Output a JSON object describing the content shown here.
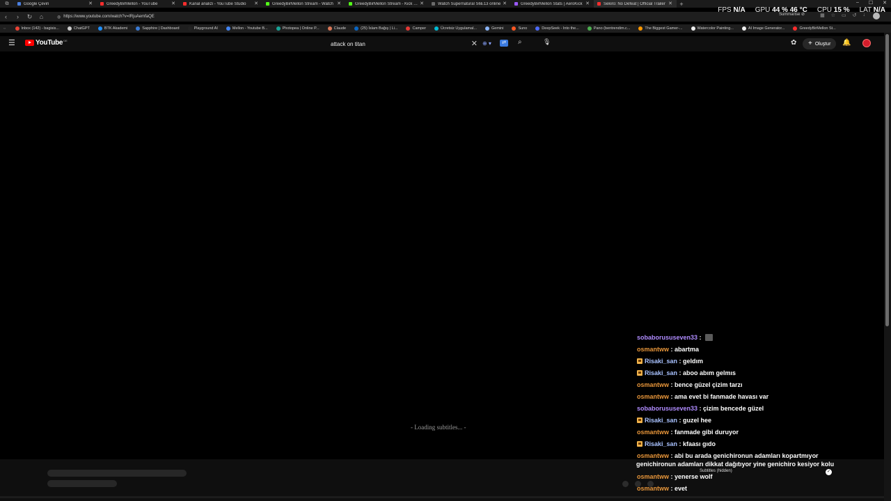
{
  "browser": {
    "tabs": [
      {
        "title": "Google Çeviri",
        "color": "#4a7fe0",
        "active": false
      },
      {
        "title": "GreedyBirMellon - YouTube",
        "color": "#ff2d2d",
        "active": false
      },
      {
        "title": "Kanal analizi - YouTube Studio",
        "color": "#ff2d2d",
        "active": false
      },
      {
        "title": "GreedyBirMellon Stream - Watch",
        "color": "#53fc18",
        "active": false
      },
      {
        "title": "GreedyBirMellon Stream - Kick Dash",
        "color": "#53fc18",
        "active": false
      },
      {
        "title": "Watch Supernatural S6E13 online",
        "color": "#6b6b6b",
        "active": false
      },
      {
        "title": "GreedyBirMellon Stats | AeroKick",
        "color": "#9b59ff",
        "active": false
      },
      {
        "title": "Sekiro: No Defeat | Official Trailer",
        "color": "#ff2d2d",
        "active": true
      }
    ],
    "new_tab": "+",
    "url": "https://www.youtube.com/watch?v=IRjuAemfaQE",
    "summarise_label": "Summarise",
    "bookmarks": [
      {
        "label": "Inbox (142) - bagisis...",
        "color": "#ea4335"
      },
      {
        "label": "ChatGPT",
        "color": "#cccccc"
      },
      {
        "label": "BTK Akademi",
        "color": "#1e90ff"
      },
      {
        "label": "Sapphire | Dashboard",
        "color": "#3a7bd5"
      },
      {
        "label": "Playground AI",
        "color": "#222222"
      },
      {
        "label": "Mellon - Youtube B...",
        "color": "#4285f4"
      },
      {
        "label": "Photopea | Online P...",
        "color": "#18a497"
      },
      {
        "label": "Claude",
        "color": "#d97757"
      },
      {
        "label": "(25) İslam Bağış | Li...",
        "color": "#0a66c2"
      },
      {
        "label": "Camper",
        "color": "#e53935"
      },
      {
        "label": "Ücretsiz Uygulamal...",
        "color": "#00bcd4"
      },
      {
        "label": "Gemini",
        "color": "#8ab4f8"
      },
      {
        "label": "Suno",
        "color": "#ff5722"
      },
      {
        "label": "DeepSeek - Into the...",
        "color": "#4d6bfe"
      },
      {
        "label": "Pano (bentrendim.c...",
        "color": "#4caf50"
      },
      {
        "label": "The Biggest Gamer-...",
        "color": "#ff9800"
      },
      {
        "label": "Watercolor Painting...",
        "color": "#eeeeee"
      },
      {
        "label": "AI Image Generator...",
        "color": "#eeeeee"
      },
      {
        "label": "GreedyBirMellon St...",
        "color": "#ff2d2d"
      }
    ]
  },
  "perf": {
    "fps_label": "FPS",
    "fps_value": "N/A",
    "gpu_label": "GPU",
    "gpu_value": "44 %",
    "gpu_temp": "46 °C",
    "cpu_label": "CPU",
    "cpu_value": "15 %",
    "lat_label": "LAT",
    "lat_value": "N/A"
  },
  "youtube": {
    "logo_text": "YouTube",
    "country_code": "DE",
    "search_value": "attack on titan",
    "create_label": "Oluştur"
  },
  "player": {
    "loading_subtitles": "- Loading subtitles... -",
    "subtitles_hidden": "Subtitles (hidden)"
  },
  "chat": {
    "messages": [
      {
        "user": "sobaborususeven33",
        "text": "",
        "user_color": "#b08cff",
        "badge": false,
        "emote": true
      },
      {
        "user": "osmantww",
        "text": "abartma",
        "user_color": "#e8963a",
        "badge": false,
        "emote": false
      },
      {
        "user": "Risaki_san",
        "text": "geldım",
        "user_color": "#a9c2ff",
        "badge": true,
        "emote": false
      },
      {
        "user": "Risaki_san",
        "text": "aboo abım gelmıs",
        "user_color": "#a9c2ff",
        "badge": true,
        "emote": false
      },
      {
        "user": "osmantww",
        "text": "bence güzel çizim tarzı",
        "user_color": "#e8963a",
        "badge": false,
        "emote": false
      },
      {
        "user": "osmantww",
        "text": "ama evet bi fanmade havası var",
        "user_color": "#e8963a",
        "badge": false,
        "emote": false
      },
      {
        "user": "sobaborususeven33",
        "text": "çizim bencede güzel",
        "user_color": "#b08cff",
        "badge": false,
        "emote": false
      },
      {
        "user": "Risaki_san",
        "text": "guzel hee",
        "user_color": "#a9c2ff",
        "badge": true,
        "emote": false
      },
      {
        "user": "osmantww",
        "text": "fanmade gibi duruyor",
        "user_color": "#e8963a",
        "badge": false,
        "emote": false
      },
      {
        "user": "Risaki_san",
        "text": "kfaası gıdo",
        "user_color": "#a9c2ff",
        "badge": true,
        "emote": false
      },
      {
        "user": "osmantww",
        "text": "abi bu arada genichironun adamları kopartmıyor",
        "user_color": "#e8963a",
        "badge": false,
        "emote": false
      }
    ],
    "wrapped_line": "genichironun adamları dikkat dağıtıyor yine genichiro kesiyor kolu",
    "tail_messages": [
      {
        "user": "osmantww",
        "text": "yenerse wolf",
        "user_color": "#e8963a"
      },
      {
        "user": "osmantww",
        "text": "evet",
        "user_color": "#e8963a"
      }
    ]
  }
}
